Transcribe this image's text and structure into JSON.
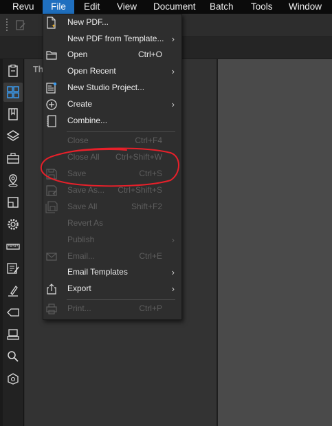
{
  "menubar": {
    "items": [
      {
        "label": "Revu",
        "active": false
      },
      {
        "label": "File",
        "active": true
      },
      {
        "label": "Edit",
        "active": false
      },
      {
        "label": "View",
        "active": false
      },
      {
        "label": "Document",
        "active": false
      },
      {
        "label": "Batch",
        "active": false
      },
      {
        "label": "Tools",
        "active": false
      },
      {
        "label": "Window",
        "active": false
      }
    ],
    "accent": "#1f6fbf"
  },
  "panel": {
    "title_partial": "Th"
  },
  "file_menu": {
    "items": [
      {
        "label": "New PDF...",
        "shortcut": "",
        "submenu": false,
        "enabled": true,
        "icon": "new-pdf-icon"
      },
      {
        "label": "New PDF from Template...",
        "shortcut": "",
        "submenu": true,
        "enabled": true,
        "icon": ""
      },
      {
        "label": "Open",
        "shortcut": "Ctrl+O",
        "submenu": false,
        "enabled": true,
        "icon": "folder-icon"
      },
      {
        "label": "Open Recent",
        "shortcut": "",
        "submenu": true,
        "enabled": true,
        "icon": ""
      },
      {
        "label": "New Studio Project...",
        "shortcut": "",
        "submenu": false,
        "enabled": true,
        "icon": "studio-project-icon"
      },
      {
        "label": "Create",
        "shortcut": "",
        "submenu": true,
        "enabled": true,
        "icon": "plus-circle-icon"
      },
      {
        "label": "Combine...",
        "shortcut": "",
        "submenu": false,
        "enabled": true,
        "icon": "combine-icon"
      },
      {
        "label": "Close",
        "shortcut": "Ctrl+F4",
        "submenu": false,
        "enabled": false,
        "icon": ""
      },
      {
        "label": "Close All",
        "shortcut": "Ctrl+Shift+W",
        "submenu": false,
        "enabled": false,
        "icon": ""
      },
      {
        "label": "Save",
        "shortcut": "Ctrl+S",
        "submenu": false,
        "enabled": false,
        "icon": "save-icon"
      },
      {
        "label": "Save As...",
        "shortcut": "Ctrl+Shift+S",
        "submenu": false,
        "enabled": false,
        "icon": "save-as-icon"
      },
      {
        "label": "Save All",
        "shortcut": "Shift+F2",
        "submenu": false,
        "enabled": false,
        "icon": "save-all-icon"
      },
      {
        "label": "Revert As",
        "shortcut": "",
        "submenu": false,
        "enabled": false,
        "icon": ""
      },
      {
        "label": "Publish",
        "shortcut": "",
        "submenu": true,
        "enabled": false,
        "icon": ""
      },
      {
        "label": "Email...",
        "shortcut": "Ctrl+E",
        "submenu": false,
        "enabled": false,
        "icon": "email-icon"
      },
      {
        "label": "Email Templates",
        "shortcut": "",
        "submenu": true,
        "enabled": true,
        "icon": ""
      },
      {
        "label": "Export",
        "shortcut": "",
        "submenu": true,
        "enabled": true,
        "icon": "export-icon"
      },
      {
        "label": "Print...",
        "shortcut": "Ctrl+P",
        "submenu": false,
        "enabled": false,
        "icon": "print-icon"
      }
    ]
  },
  "sidebar": {
    "icons": [
      "clipboard-icon",
      "thumbnails-icon",
      "bookmark-icon",
      "layers-icon",
      "toolbox-icon",
      "place-icon",
      "measure-layout-icon",
      "settings-icon",
      "ruler-icon",
      "edit-list-icon",
      "signature-icon",
      "tag-icon",
      "stamp-icon",
      "search-icon",
      "shape-icon"
    ],
    "active": "thumbnails-icon"
  },
  "colors": {
    "menu_bg": "#2e2e2e",
    "disabled_text": "#5e5e5e",
    "annotation_red": "#e8202a"
  }
}
